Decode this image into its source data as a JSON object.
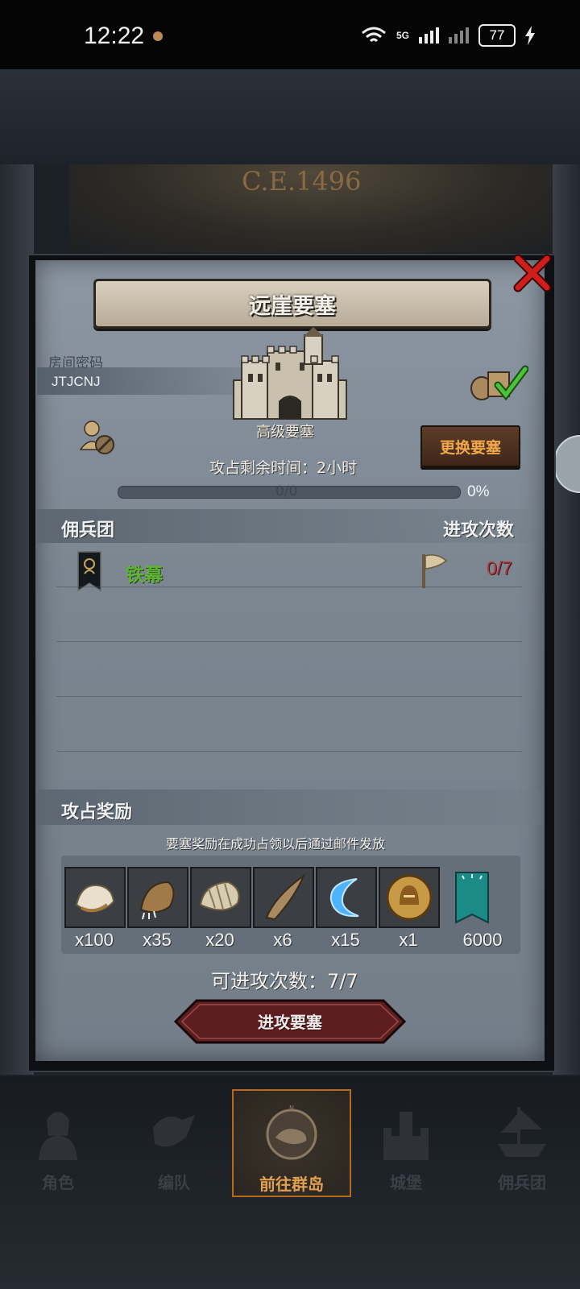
{
  "status_bar": {
    "time": "12:22",
    "network": "5G",
    "battery": "77"
  },
  "era": "C.E.1496",
  "panel": {
    "title": "远崖要塞",
    "room_label": "房间密码",
    "room_code": "JTJCNJ",
    "fortress_level": "高级要塞",
    "change_button": "更换要塞",
    "remaining_time": "攻占剩余时间：2小时",
    "progress_text": "0/0",
    "progress_percent": "0%",
    "progress_value": 0,
    "mercenary_header": "佣兵团",
    "attack_count_header": "进攻次数",
    "mercenaries": [
      {
        "name": "铁幕",
        "attacks": "0/7"
      }
    ],
    "reward_header": "攻占奖励",
    "reward_note": "要塞奖励在成功占领以后通过邮件发放",
    "rewards": [
      {
        "icon": "white-fur-icon",
        "qty": "x100"
      },
      {
        "icon": "brown-claw-pelt-icon",
        "qty": "x35"
      },
      {
        "icon": "striped-pelt-icon",
        "qty": "x20"
      },
      {
        "icon": "horn-icon",
        "qty": "x6"
      },
      {
        "icon": "blue-crescent-icon",
        "qty": "x15"
      },
      {
        "icon": "golden-helmet-coin-icon",
        "qty": "x1"
      },
      {
        "icon": "guild-banner-icon",
        "qty": "6000"
      }
    ],
    "attempts": "可进攻次数：7/7",
    "attack_button": "进攻要塞"
  },
  "nav": [
    {
      "label": "角色",
      "icon": "knight-icon",
      "active": false
    },
    {
      "label": "编队",
      "icon": "formation-icon",
      "active": false
    },
    {
      "label": "前往群岛",
      "icon": "compass-map-icon",
      "active": true
    },
    {
      "label": "城堡",
      "icon": "castle-icon",
      "active": false
    },
    {
      "label": "佣兵团",
      "icon": "ship-icon",
      "active": false
    }
  ],
  "colors": {
    "accent_orange": "#f0a84a",
    "green_name": "#5fb436",
    "red_count": "#b23838",
    "close_red": "#d21d1d"
  }
}
